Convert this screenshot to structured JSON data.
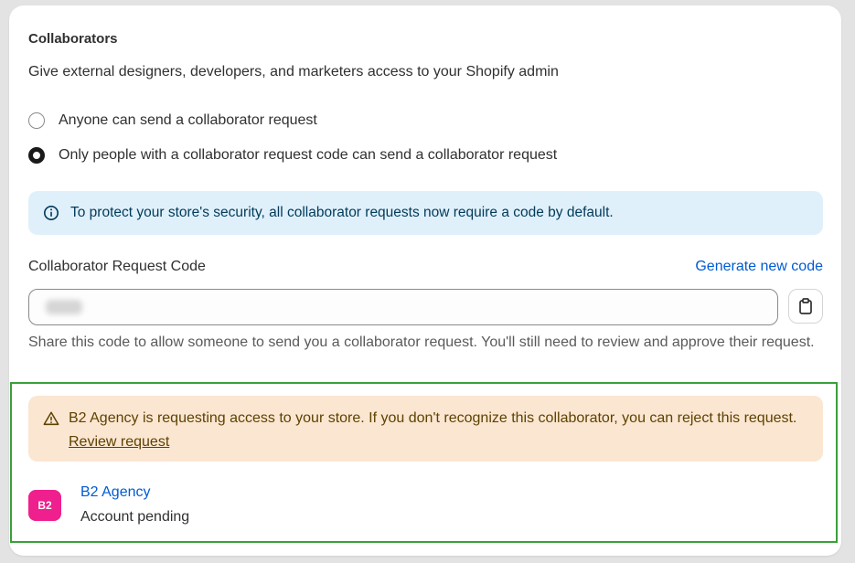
{
  "collaborators": {
    "title": "Collaborators",
    "subtitle": "Give external designers, developers, and marketers access to your Shopify admin",
    "options": [
      {
        "label": "Anyone can send a collaborator request",
        "selected": false
      },
      {
        "label": "Only people with a collaborator request code can send a collaborator request",
        "selected": true
      }
    ],
    "info_banner": "To protect your store's security, all collaborator requests now require a code by default.",
    "code_label": "Collaborator Request Code",
    "generate_link": "Generate new code",
    "code_help": "Share this code to allow someone to send you a collaborator request. You'll still need to review and approve their request."
  },
  "pending_request": {
    "warning_text": "B2 Agency is requesting access to your store. If you don't recognize this collaborator, you can reject this request.",
    "review_link": "Review request",
    "avatar_initials": "B2",
    "collaborator_name": "B2 Agency",
    "status": "Account pending"
  },
  "colors": {
    "link": "#005bd3",
    "info_bg": "#e0f0fa",
    "warning_bg": "#fbe6d2",
    "avatar_bg": "#ef1f8d",
    "highlight_border": "#3aa03a"
  },
  "icons": {
    "info": "info-circle-icon",
    "copy": "clipboard-icon",
    "warning": "alert-triangle-icon"
  }
}
